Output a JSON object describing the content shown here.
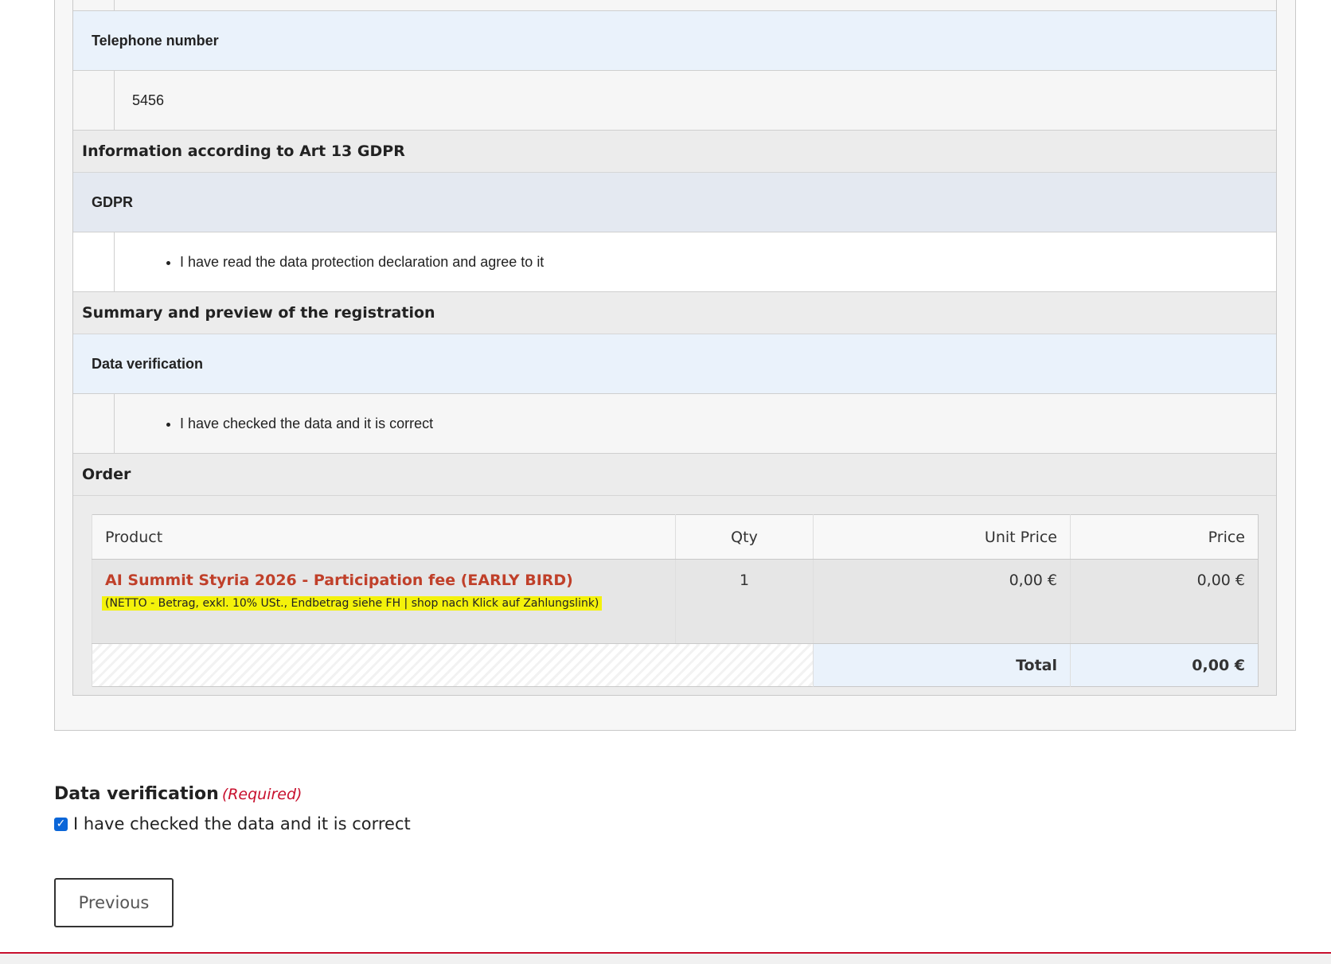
{
  "fields": {
    "telephone": {
      "label": "Telephone number",
      "value": "5456"
    },
    "gdpr_section": "Information according to Art 13 GDPR",
    "gdpr": {
      "label": "GDPR",
      "value": "I have read the data protection declaration and agree to it"
    },
    "summary_section": "Summary and preview of the registration",
    "data_verification": {
      "label": "Data verification",
      "value": "I have checked the data and it is correct"
    },
    "order_section": "Order"
  },
  "order": {
    "headers": {
      "product": "Product",
      "qty": "Qty",
      "unit_price": "Unit Price",
      "price": "Price"
    },
    "items": [
      {
        "name": "AI Summit Styria 2026 - Participation fee (EARLY BIRD)",
        "note": "(NETTO - Betrag, exkl. 10% USt., Endbetrag siehe FH | shop nach Klick auf Zahlungslink)",
        "qty": "1",
        "unit_price": "0,00 €",
        "price": "0,00 €"
      }
    ],
    "total_label": "Total",
    "total_value": "0,00 €"
  },
  "verification": {
    "title": "Data verification",
    "required": "(Required)",
    "checkbox_label": "I have checked the data and it is correct",
    "checked": true
  },
  "buttons": {
    "previous": "Previous"
  },
  "colors": {
    "accent": "#c8102e",
    "product_name": "#c0402a",
    "highlight": "#f4f20b",
    "checkbox": "#0b66d8"
  }
}
